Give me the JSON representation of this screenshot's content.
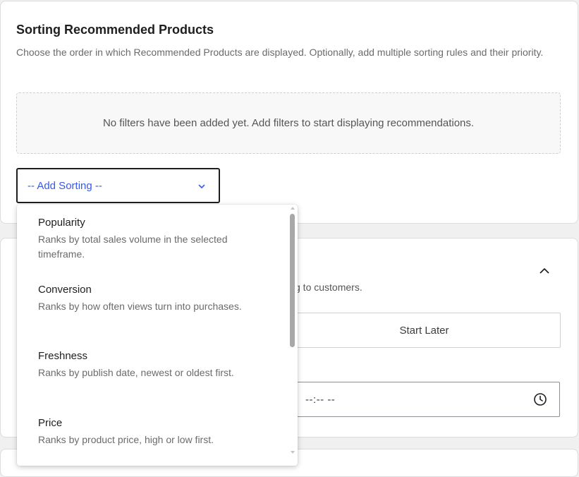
{
  "sorting": {
    "title": "Sorting Recommended Products",
    "description": "Choose the order in which Recommended Products are displayed. Optionally, add multiple sorting rules and their priority.",
    "empty_state": "No filters have been added yet. Add filters to start displaying recommendations.",
    "select": {
      "value": "-- Add Sorting --",
      "chevron_icon": "chevron-down-icon"
    },
    "options": [
      {
        "label": "Popularity",
        "description": "Ranks by total sales volume in the selected timeframe."
      },
      {
        "label": "Conversion",
        "description": "Ranks by how often views turn into purchases."
      },
      {
        "label": "Freshness",
        "description": "Ranks by publish date, newest or oldest first."
      },
      {
        "label": "Price",
        "description": "Ranks by product price, high or low first."
      }
    ]
  },
  "schedule": {
    "partial_description": "g to customers.",
    "start_later_label": "Start Later",
    "time_value": "--:-- --",
    "collapse_icon": "chevron-up-icon",
    "clock_icon": "clock-icon"
  },
  "colors": {
    "accent": "#3858e9",
    "text": "#1e1e1e",
    "muted": "#6b6b6b",
    "background": "#f0f0f1"
  }
}
